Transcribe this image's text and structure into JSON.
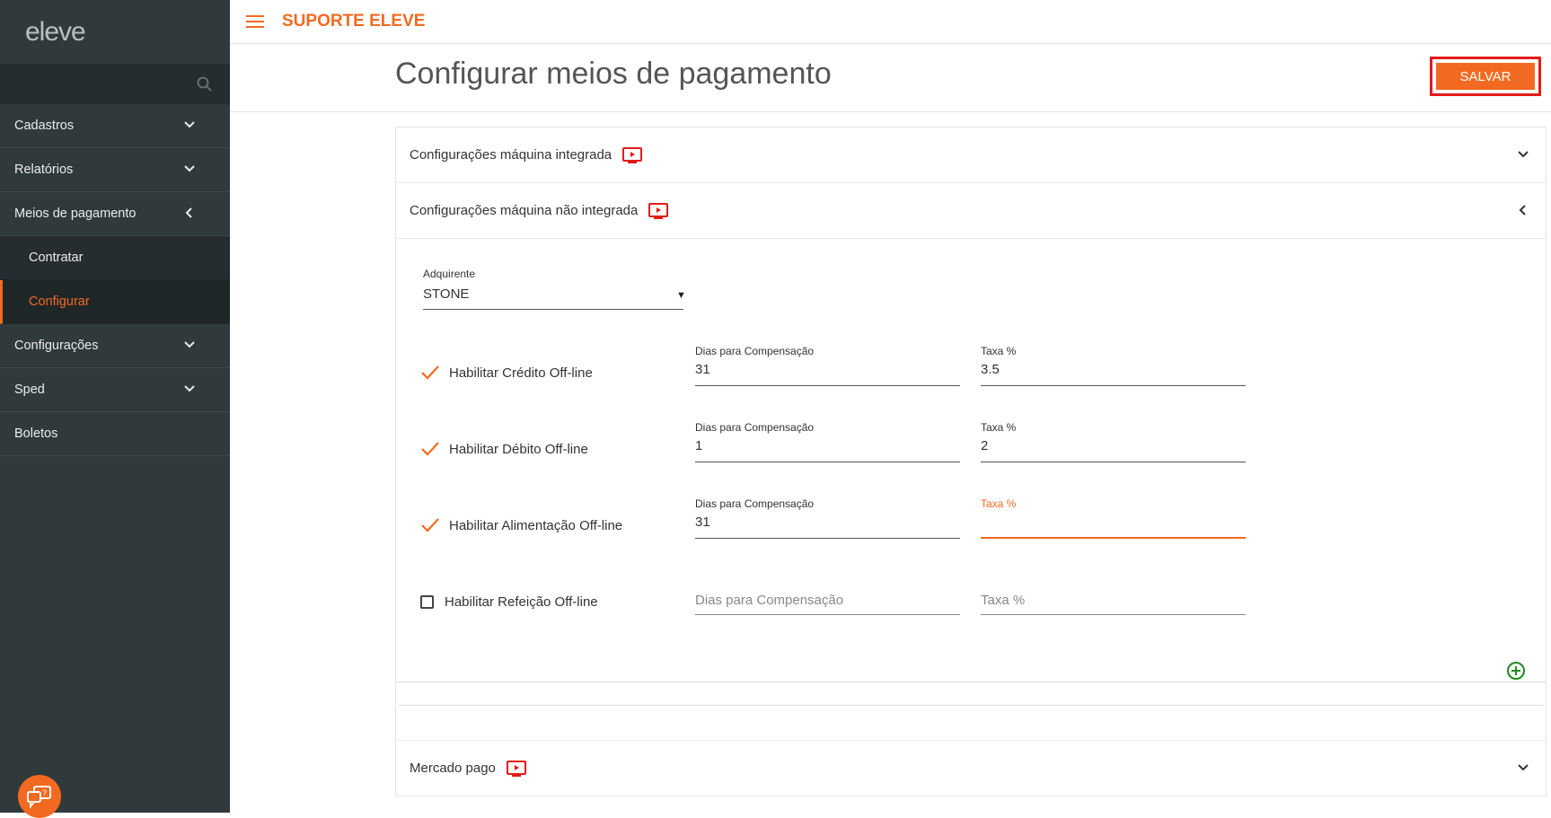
{
  "sidebar": {
    "logo": "eleve",
    "items": [
      {
        "label": "Cadastros"
      },
      {
        "label": "Relatórios"
      },
      {
        "label": "Meios de pagamento"
      },
      {
        "label": "Contratar"
      },
      {
        "label": "Configurar"
      },
      {
        "label": "Configurações"
      },
      {
        "label": "Sped"
      },
      {
        "label": "Boletos"
      }
    ]
  },
  "topbar": {
    "brand": "SUPORTE ELEVE"
  },
  "header": {
    "title": "Configurar meios de pagamento",
    "save_label": "SALVAR"
  },
  "panels": {
    "integrada": "Configurações máquina integrada",
    "nao_integrada": "Configurações máquina não integrada",
    "mercado_pago": "Mercado pago"
  },
  "form": {
    "adquirente_label": "Adquirente",
    "adquirente_value": "STONE",
    "rows": [
      {
        "label": "Habilitar Crédito Off-line",
        "dias_label": "Dias para Compensação",
        "dias": "31",
        "taxa_label": "Taxa %",
        "taxa": "3.5"
      },
      {
        "label": "Habilitar Débito Off-line",
        "dias_label": "Dias para Compensação",
        "dias": "1",
        "taxa_label": "Taxa %",
        "taxa": "2"
      },
      {
        "label": "Habilitar Alimentação Off-line",
        "dias_label": "Dias para Compensação",
        "dias": "31",
        "taxa_label": "Taxa %",
        "taxa": ""
      },
      {
        "label": "Habilitar Refeição Off-line",
        "dias_placeholder": "Dias para Compensação",
        "taxa_placeholder": "Taxa %"
      }
    ]
  },
  "colors": {
    "accent": "#f26a21",
    "sidebar_bg": "#303a3d",
    "highlight": "#e31a1a",
    "add": "#1f8a1f",
    "video": "#e31a1a"
  }
}
